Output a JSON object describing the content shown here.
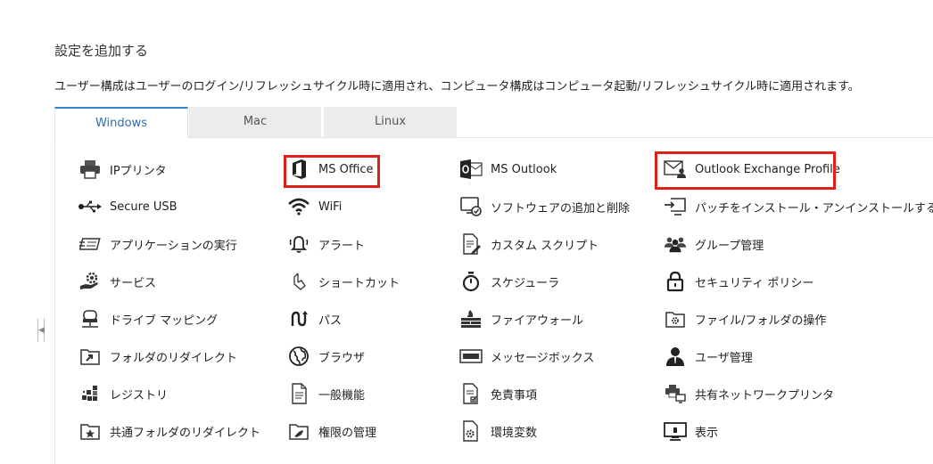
{
  "heading": "設定を追加する",
  "description": "ユーザー構成はユーザーのログイン/リフレッシュサイクル時に適用され、コンピュータ構成はコンピュータ起動/リフレッシュサイクル時に適用されます。",
  "tabs": [
    {
      "label": "Windows",
      "active": true
    },
    {
      "label": "Mac",
      "active": false
    },
    {
      "label": "Linux",
      "active": false
    }
  ],
  "items": {
    "col1": [
      {
        "label": "IPプリンタ",
        "icon": "printer-icon"
      },
      {
        "label": "Secure USB",
        "icon": "usb-icon"
      },
      {
        "label": "アプリケーションの実行",
        "icon": "run-application-icon"
      },
      {
        "label": "サービス",
        "icon": "service-gear-icon"
      },
      {
        "label": "ドライブ マッピング",
        "icon": "drive-mapping-icon"
      },
      {
        "label": "フォルダのリダイレクト",
        "icon": "folder-redirect-icon"
      },
      {
        "label": "レジストリ",
        "icon": "registry-icon"
      },
      {
        "label": "共通フォルダのリダイレクト",
        "icon": "common-folder-icon"
      }
    ],
    "col2": [
      {
        "label": "MS Office",
        "icon": "ms-office-icon"
      },
      {
        "label": "WiFi",
        "icon": "wifi-icon"
      },
      {
        "label": "アラート",
        "icon": "alert-bell-icon"
      },
      {
        "label": "ショートカット",
        "icon": "shortcut-icon"
      },
      {
        "label": "パス",
        "icon": "path-icon"
      },
      {
        "label": "ブラウザ",
        "icon": "browser-globe-icon"
      },
      {
        "label": "一般機能",
        "icon": "document-icon"
      },
      {
        "label": "権限の管理",
        "icon": "permission-folder-icon"
      }
    ],
    "col3": [
      {
        "label": "MS Outlook",
        "icon": "ms-outlook-icon"
      },
      {
        "label": "ソフトウェアの追加と削除",
        "icon": "software-install-icon"
      },
      {
        "label": "カスタム スクリプト",
        "icon": "script-icon"
      },
      {
        "label": "スケジューラ",
        "icon": "stopwatch-icon"
      },
      {
        "label": "ファイアウォール",
        "icon": "firewall-icon"
      },
      {
        "label": "メッセージボックス",
        "icon": "message-box-icon"
      },
      {
        "label": "免責事項",
        "icon": "disclaimer-icon"
      },
      {
        "label": "環境変数",
        "icon": "environment-variable-icon"
      }
    ],
    "col4": [
      {
        "label": "Outlook Exchange Profile",
        "icon": "exchange-profile-icon"
      },
      {
        "label": "パッチをインストール・アンインストールする",
        "icon": "patch-install-icon"
      },
      {
        "label": "グループ管理",
        "icon": "group-icon"
      },
      {
        "label": "セキュリティ ポリシー",
        "icon": "lock-icon"
      },
      {
        "label": "ファイル/フォルダの操作",
        "icon": "file-folder-icon"
      },
      {
        "label": "ユーザ管理",
        "icon": "user-icon"
      },
      {
        "label": "共有ネットワークプリンタ",
        "icon": "network-printer-icon"
      },
      {
        "label": "表示",
        "icon": "display-icon"
      }
    ]
  },
  "highlight_color": "#e0201b",
  "active_tab_color": "#2a89c8"
}
